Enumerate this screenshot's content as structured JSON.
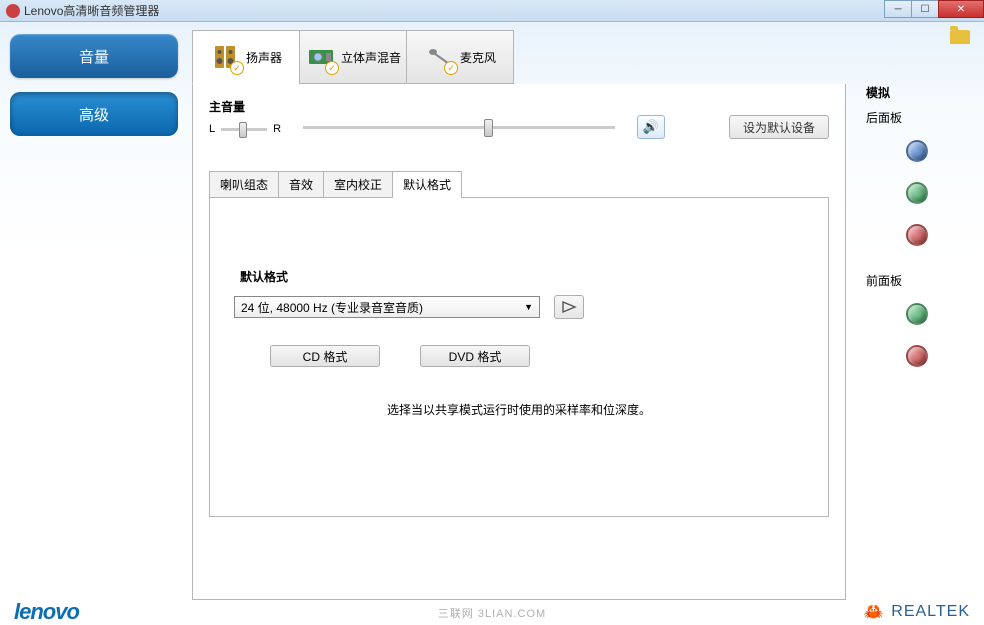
{
  "window": {
    "title": "Lenovo高清晰音频管理器"
  },
  "sidebar": {
    "items": [
      {
        "label": "音量"
      },
      {
        "label": "高级"
      }
    ]
  },
  "deviceTabs": [
    {
      "label": "扬声器"
    },
    {
      "label": "立体声混音"
    },
    {
      "label": "麦克风"
    }
  ],
  "volume": {
    "title": "主音量",
    "left": "L",
    "right": "R",
    "defaultBtn": "设为默认设备"
  },
  "subTabs": [
    {
      "label": "喇叭组态"
    },
    {
      "label": "音效"
    },
    {
      "label": "室内校正"
    },
    {
      "label": "默认格式"
    }
  ],
  "format": {
    "title": "默认格式",
    "selected": "24 位, 48000 Hz (专业录音室音质)",
    "cdBtn": "CD 格式",
    "dvdBtn": "DVD 格式",
    "desc": "选择当以共享模式运行时使用的采样率和位深度。"
  },
  "rightPanel": {
    "title": "模拟",
    "rear": "后面板",
    "front": "前面板"
  },
  "footer": {
    "lenovo": "lenovo",
    "realtek": "REALTEK"
  },
  "watermark": "三联网  3LIAN.COM"
}
